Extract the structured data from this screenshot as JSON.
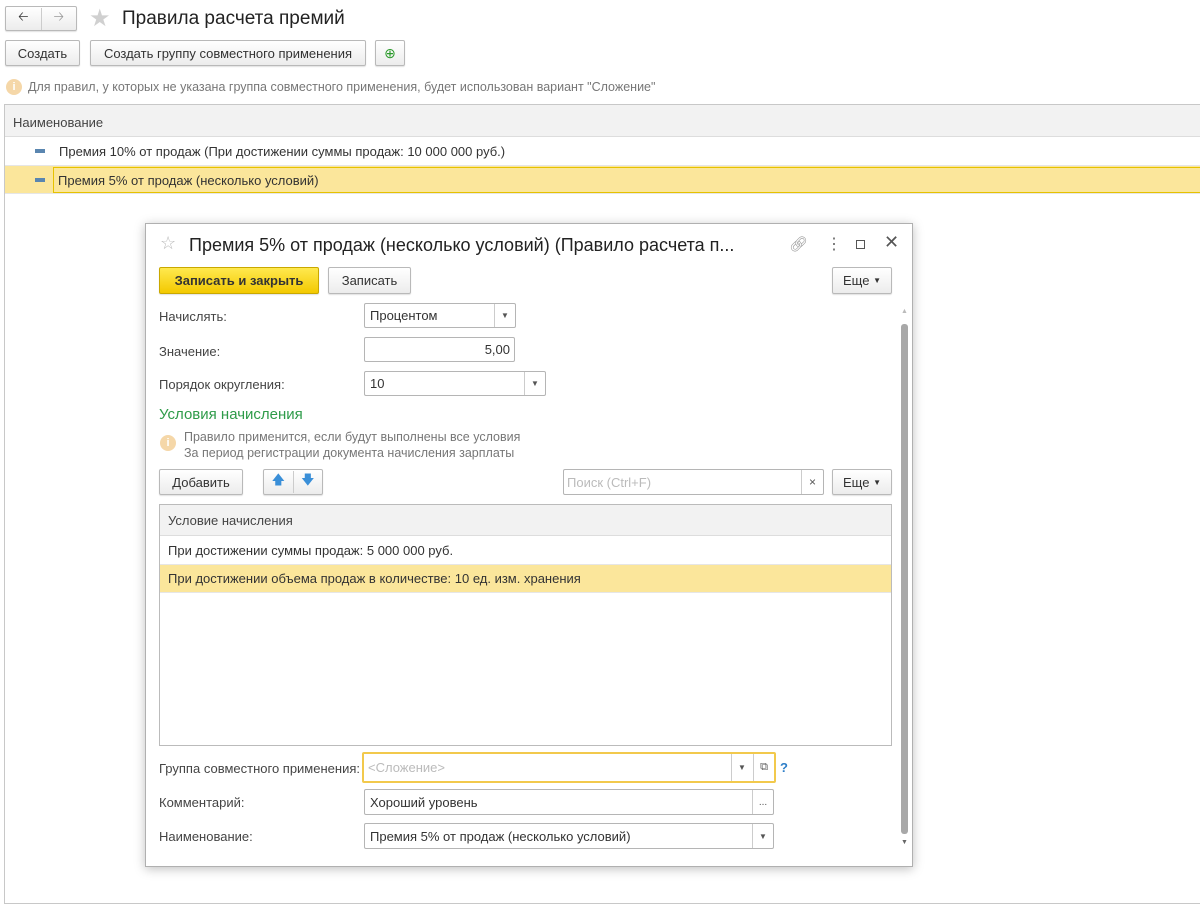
{
  "main": {
    "title": "Правила расчета премий",
    "create_label": "Создать",
    "create_group_label": "Создать группу совместного применения",
    "info_text": "Для правил, у которых не указана группа совместного применения, будет использован вариант \"Сложение\"",
    "column_header": "Наименование",
    "rows": [
      {
        "label": "Премия 10% от продаж (При достижении суммы продаж: 10 000 000 руб.)"
      },
      {
        "label": "Премия 5% от продаж (несколько условий)",
        "selected": true
      }
    ]
  },
  "dialog": {
    "title": "Премия 5% от продаж (несколько условий) (Правило расчета п...",
    "save_close_label": "Записать и закрыть",
    "save_label": "Записать",
    "more_label": "Еще",
    "accrue_label": "Начислять:",
    "accrue_value": "Процентом",
    "value_label": "Значение:",
    "value_value": "5,00",
    "rounding_label": "Порядок округления:",
    "rounding_value": "10",
    "conditions_heading": "Условия начисления",
    "conditions_info_1": "Правило применится, если будут выполнены все условия",
    "conditions_info_2": "За период регистрации документа начисления зарплаты",
    "add_label": "Добавить",
    "search_placeholder": "Поиск (Ctrl+F)",
    "search_clear": "×",
    "table_header": "Условие начисления",
    "conditions": [
      {
        "label": "При достижении суммы продаж: 5 000 000 руб."
      },
      {
        "label": "При достижении объема продаж в количестве: 10 ед. изм. хранения",
        "selected": true
      }
    ],
    "group_label": "Группа совместного применения:",
    "group_placeholder": "<Сложение>",
    "help": "?",
    "comment_label": "Комментарий:",
    "comment_value": "Хороший уровень",
    "comment_btn": "...",
    "name_label": "Наименование:",
    "name_value": "Премия 5% от продаж (несколько условий)"
  },
  "colors": {
    "accent_yellow": "#f5d000",
    "selected_row": "#fbe69b",
    "heading_green": "#2e9b49"
  }
}
